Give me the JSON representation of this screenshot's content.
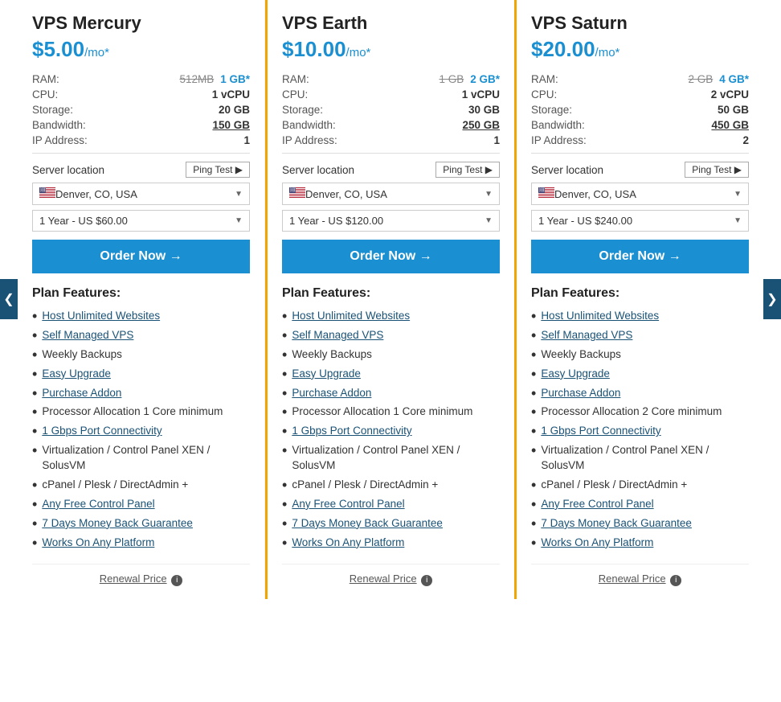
{
  "nav": {
    "left_arrow": "❮",
    "right_arrow": "❯"
  },
  "plans": [
    {
      "id": "mercury",
      "name": "VPS Mercury",
      "price": "$5.00",
      "price_suffix": "/mo*",
      "specs": {
        "ram_old": "512MB",
        "ram_new": "1 GB*",
        "cpu": "1 vCPU",
        "storage": "20 GB",
        "bandwidth": "150 GB",
        "bandwidth_underline": true,
        "ip": "1"
      },
      "server_location_label": "Server location",
      "ping_btn": "Ping Test ▶",
      "location": "Denver, CO, USA",
      "billing": "1 Year - US $60.00",
      "order_btn": "Order Now →",
      "features_title": "Plan Features:",
      "features": [
        {
          "text": "Host Unlimited Websites",
          "link": true,
          "bullet": "•"
        },
        {
          "text": "Self Managed VPS",
          "link": true,
          "bullet": "•"
        },
        {
          "text": "Weekly Backups",
          "link": false,
          "bullet": "•"
        },
        {
          "text": "Easy Upgrade",
          "link": true,
          "bullet": "•"
        },
        {
          "text": "Purchase Addon",
          "link": true,
          "bullet": "•"
        },
        {
          "text": "Processor Allocation 1 Core minimum",
          "link": false,
          "bullet": "•"
        },
        {
          "text": "1 Gbps Port Connectivity",
          "link": true,
          "bullet": "•"
        },
        {
          "text": "Virtualization / Control Panel XEN / SolusVM",
          "link": false,
          "bullet": "•"
        },
        {
          "text": "cPanel / Plesk / DirectAdmin +",
          "link": false,
          "bullet": "•"
        },
        {
          "text": "Any Free Control Panel",
          "link": true,
          "bullet": "•"
        },
        {
          "text": "7 Days Money Back Guarantee",
          "link": true,
          "bullet": "•"
        },
        {
          "text": "Works On Any Platform",
          "link": true,
          "bullet": "•"
        }
      ],
      "renewal_label": "Renewal Price",
      "highlighted": false
    },
    {
      "id": "earth",
      "name": "VPS Earth",
      "price": "$10.00",
      "price_suffix": "/mo*",
      "specs": {
        "ram_old": "1 GB",
        "ram_new": "2 GB*",
        "cpu": "1 vCPU",
        "storage": "30 GB",
        "bandwidth": "250 GB",
        "bandwidth_underline": true,
        "ip": "1"
      },
      "server_location_label": "Server location",
      "ping_btn": "Ping Test ▶",
      "location": "Denver, CO, USA",
      "billing": "1 Year - US $120.00",
      "order_btn": "Order Now →",
      "features_title": "Plan Features:",
      "features": [
        {
          "text": "Host Unlimited Websites",
          "link": true,
          "bullet": "•"
        },
        {
          "text": "Self Managed VPS",
          "link": true,
          "bullet": "•"
        },
        {
          "text": "Weekly Backups",
          "link": false,
          "bullet": "•"
        },
        {
          "text": "Easy Upgrade",
          "link": true,
          "bullet": "•"
        },
        {
          "text": "Purchase Addon",
          "link": true,
          "bullet": "•"
        },
        {
          "text": "Processor Allocation 1 Core minimum",
          "link": false,
          "bullet": "•"
        },
        {
          "text": "1 Gbps Port Connectivity",
          "link": true,
          "bullet": "•"
        },
        {
          "text": "Virtualization / Control Panel XEN / SolusVM",
          "link": false,
          "bullet": "•"
        },
        {
          "text": "cPanel / Plesk / DirectAdmin +",
          "link": false,
          "bullet": "•"
        },
        {
          "text": "Any Free Control Panel",
          "link": true,
          "bullet": "•"
        },
        {
          "text": "7 Days Money Back Guarantee",
          "link": true,
          "bullet": "•"
        },
        {
          "text": "Works On Any Platform",
          "link": true,
          "bullet": "•"
        }
      ],
      "renewal_label": "Renewal Price",
      "highlighted": true
    },
    {
      "id": "saturn",
      "name": "VPS Saturn",
      "price": "$20.00",
      "price_suffix": "/mo*",
      "specs": {
        "ram_old": "2 GB",
        "ram_new": "4 GB*",
        "cpu": "2 vCPU",
        "storage": "50 GB",
        "bandwidth": "450 GB",
        "bandwidth_underline": true,
        "ip": "2"
      },
      "server_location_label": "Server location",
      "ping_btn": "Ping Test ▶",
      "location": "Denver, CO, USA",
      "billing": "1 Year - US $240.00",
      "order_btn": "Order Now →",
      "features_title": "Plan Features:",
      "features": [
        {
          "text": "Host Unlimited Websites",
          "link": true,
          "bullet": "•"
        },
        {
          "text": "Self Managed VPS",
          "link": true,
          "bullet": "•"
        },
        {
          "text": "Weekly Backups",
          "link": false,
          "bullet": "•"
        },
        {
          "text": "Easy Upgrade",
          "link": true,
          "bullet": "•"
        },
        {
          "text": "Purchase Addon",
          "link": true,
          "bullet": "•"
        },
        {
          "text": "Processor Allocation 2 Core minimum",
          "link": false,
          "bullet": "•"
        },
        {
          "text": "1 Gbps Port Connectivity",
          "link": true,
          "bullet": "•"
        },
        {
          "text": "Virtualization / Control Panel XEN / SolusVM",
          "link": false,
          "bullet": "•"
        },
        {
          "text": "cPanel / Plesk / DirectAdmin +",
          "link": false,
          "bullet": "•"
        },
        {
          "text": "Any Free Control Panel",
          "link": true,
          "bullet": "•"
        },
        {
          "text": "7 Days Money Back Guarantee",
          "link": true,
          "bullet": "•"
        },
        {
          "text": "Works On Any Platform",
          "link": true,
          "bullet": "•"
        }
      ],
      "renewal_label": "Renewal Price",
      "highlighted": false
    }
  ]
}
